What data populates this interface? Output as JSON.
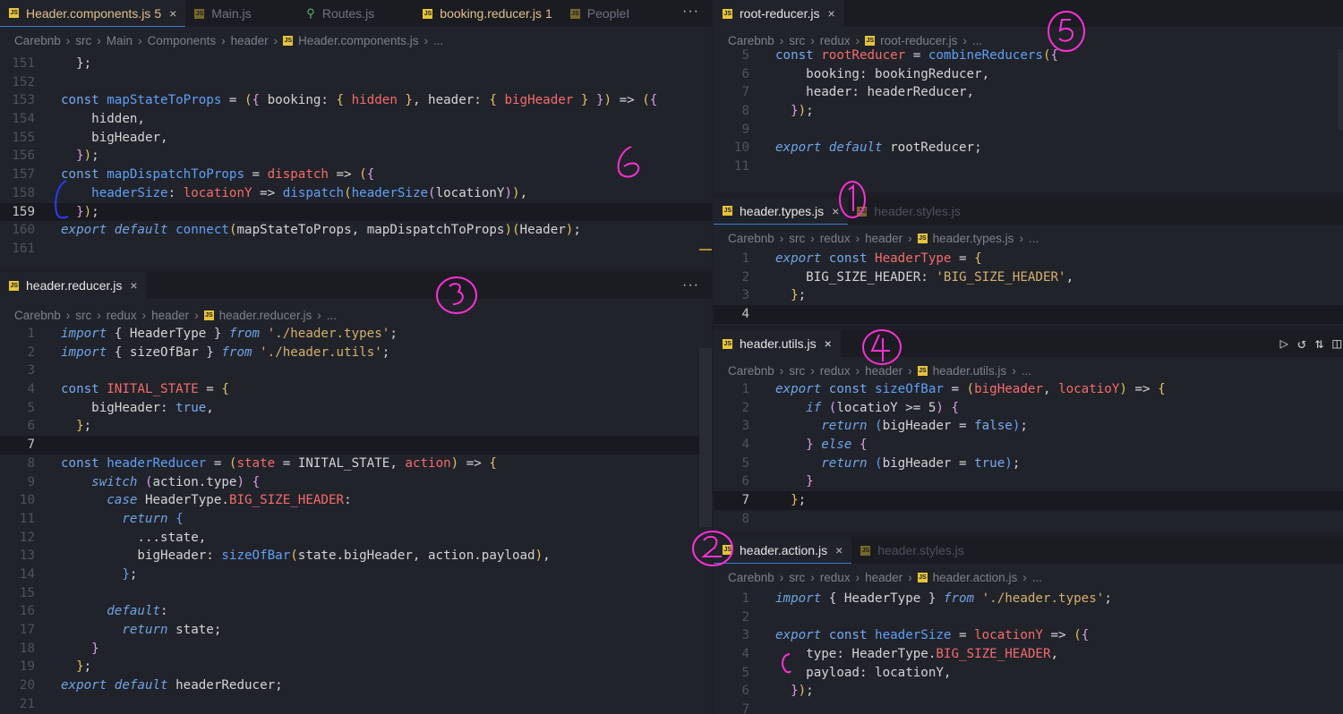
{
  "panes": {
    "header_components": {
      "tabs": [
        {
          "icon": "js-file-icon",
          "label": "Header.components.js",
          "badge": "5",
          "active": true,
          "modified": true
        },
        {
          "icon": "js-file-icon",
          "label": "Main.js",
          "active": false
        },
        {
          "icon": "routes-icon",
          "label": "Routes.js",
          "active": false
        },
        {
          "icon": "js-file-icon",
          "label": "booking.reducer.js",
          "badge": "1",
          "active": false,
          "modified": true
        },
        {
          "icon": "js-file-icon",
          "label": "PeopleI",
          "active": false
        }
      ],
      "more": "···",
      "breadcrumb": [
        "Carebnb",
        "src",
        "Main",
        "Components",
        "header",
        "Header.components.js",
        "..."
      ]
    },
    "header_reducer": {
      "tab": "header.reducer.js",
      "more": "···",
      "breadcrumb": [
        "Carebnb",
        "src",
        "redux",
        "header",
        "header.reducer.js",
        "..."
      ]
    },
    "root_reducer": {
      "tab": "root-reducer.js",
      "breadcrumb": [
        "Carebnb",
        "src",
        "redux",
        "root-reducer.js",
        "..."
      ]
    },
    "header_types": {
      "tabs": [
        "header.types.js",
        "header.styles.js"
      ],
      "breadcrumb": [
        "Carebnb",
        "src",
        "redux",
        "header",
        "header.types.js",
        "..."
      ]
    },
    "header_utils": {
      "tab": "header.utils.js",
      "breadcrumb": [
        "Carebnb",
        "src",
        "redux",
        "header",
        "header.utils.js",
        "..."
      ],
      "actions": [
        "run-icon",
        "history-icon",
        "compare-icon",
        "split-editor-icon"
      ]
    },
    "header_action": {
      "tabs": [
        "header.action.js",
        "header.styles.js"
      ],
      "breadcrumb": [
        "Carebnb",
        "src",
        "redux",
        "header",
        "header.action.js",
        "..."
      ]
    }
  },
  "close_glyph": "×",
  "annotations": [
    "1",
    "2",
    "3",
    "4",
    "5",
    "6"
  ],
  "code": {
    "header_components": [
      {
        "n": "151",
        "tokens": [
          [
            "tx",
            "  };"
          ]
        ]
      },
      {
        "n": "152",
        "tokens": []
      },
      {
        "n": "153",
        "tokens": [
          [
            "k",
            "const "
          ],
          [
            "fn",
            "mapStateToProps"
          ],
          [
            "tx",
            " = "
          ],
          [
            "br",
            "("
          ],
          [
            "pn",
            "{ "
          ],
          [
            "tx",
            "booking: "
          ],
          [
            "br",
            "{ "
          ],
          [
            "var",
            "hidden"
          ],
          [
            "br",
            " }"
          ],
          [
            "tx",
            ", header: "
          ],
          [
            "br",
            "{ "
          ],
          [
            "var",
            "bigHeader"
          ],
          [
            "br",
            " }"
          ],
          [
            "pn",
            " }"
          ],
          [
            "br",
            ")"
          ],
          [
            "tx",
            " => "
          ],
          [
            "br",
            "("
          ],
          [
            "pn",
            "{"
          ]
        ]
      },
      {
        "n": "154",
        "tokens": [
          [
            "tx",
            "    hidden,"
          ]
        ]
      },
      {
        "n": "155",
        "tokens": [
          [
            "tx",
            "    bigHeader,"
          ]
        ]
      },
      {
        "n": "156",
        "tokens": [
          [
            "pn",
            "  }"
          ],
          [
            "br",
            ")"
          ],
          [
            "tx",
            ";"
          ]
        ]
      },
      {
        "n": "157",
        "tokens": [
          [
            "k",
            "const "
          ],
          [
            "fn",
            "mapDispatchToProps"
          ],
          [
            "tx",
            " = "
          ],
          [
            "var",
            "dispatch"
          ],
          [
            "tx",
            " => "
          ],
          [
            "br",
            "("
          ],
          [
            "pn",
            "{"
          ]
        ]
      },
      {
        "n": "158",
        "tokens": [
          [
            "tx",
            "    "
          ],
          [
            "fn",
            "headerSize"
          ],
          [
            "tx",
            ": "
          ],
          [
            "var",
            "locationY"
          ],
          [
            "tx",
            " => "
          ],
          [
            "fn",
            "dispatch"
          ],
          [
            "br",
            "("
          ],
          [
            "fn",
            "headerSize"
          ],
          [
            "pn",
            "("
          ],
          [
            "tx",
            "locationY"
          ],
          [
            "pn",
            ")"
          ],
          [
            "br",
            ")"
          ],
          [
            "tx",
            ","
          ]
        ]
      },
      {
        "n": "159",
        "tokens": [
          [
            "pn",
            "  }"
          ],
          [
            "br",
            ")"
          ],
          [
            "tx",
            ";"
          ]
        ],
        "current": true
      },
      {
        "n": "160",
        "tokens": [
          [
            "kw",
            "export "
          ],
          [
            "kw",
            "default "
          ],
          [
            "fn",
            "connect"
          ],
          [
            "br",
            "("
          ],
          [
            "tx",
            "mapStateToProps, mapDispatchToProps"
          ],
          [
            "br",
            ")"
          ],
          [
            "br",
            "("
          ],
          [
            "tx",
            "Header"
          ],
          [
            "br",
            ")"
          ],
          [
            "tx",
            ";"
          ]
        ]
      },
      {
        "n": "161",
        "tokens": []
      }
    ],
    "header_reducer": [
      {
        "n": "1",
        "tokens": [
          [
            "kw",
            "import "
          ],
          [
            "tx",
            "{ HeaderType } "
          ],
          [
            "kw",
            "from "
          ],
          [
            "str",
            "'./header.types'"
          ],
          [
            "tx",
            ";"
          ]
        ]
      },
      {
        "n": "2",
        "tokens": [
          [
            "kw",
            "import "
          ],
          [
            "tx",
            "{ sizeOfBar } "
          ],
          [
            "kw",
            "from "
          ],
          [
            "str",
            "'./header.utils'"
          ],
          [
            "tx",
            ";"
          ]
        ]
      },
      {
        "n": "3",
        "tokens": []
      },
      {
        "n": "4",
        "tokens": [
          [
            "k",
            "const "
          ],
          [
            "var",
            "INITAL_STATE"
          ],
          [
            "tx",
            " = "
          ],
          [
            "br",
            "{"
          ]
        ]
      },
      {
        "n": "5",
        "tokens": [
          [
            "tx",
            "    bigHeader: "
          ],
          [
            "k",
            "true"
          ],
          [
            "tx",
            ","
          ]
        ]
      },
      {
        "n": "6",
        "tokens": [
          [
            "br",
            "  }"
          ],
          [
            "tx",
            ";"
          ]
        ]
      },
      {
        "n": "7",
        "tokens": [],
        "current": true
      },
      {
        "n": "8",
        "tokens": [
          [
            "k",
            "const "
          ],
          [
            "fn",
            "headerReducer"
          ],
          [
            "tx",
            " = "
          ],
          [
            "br",
            "("
          ],
          [
            "var",
            "state"
          ],
          [
            "tx",
            " = "
          ],
          [
            "tx",
            "INITAL_STATE"
          ],
          [
            "tx",
            ", "
          ],
          [
            "var",
            "action"
          ],
          [
            "br",
            ")"
          ],
          [
            "tx",
            " => "
          ],
          [
            "br",
            "{"
          ]
        ]
      },
      {
        "n": "9",
        "tokens": [
          [
            "kw",
            "    switch "
          ],
          [
            "pn",
            "("
          ],
          [
            "tx",
            "action.type"
          ],
          [
            "pn",
            ")"
          ],
          [
            "pn",
            " {"
          ]
        ]
      },
      {
        "n": "10",
        "tokens": [
          [
            "kw",
            "      case "
          ],
          [
            "tx",
            "HeaderType."
          ],
          [
            "var",
            "BIG_SIZE_HEADER"
          ],
          [
            "tx",
            ":"
          ]
        ]
      },
      {
        "n": "11",
        "tokens": [
          [
            "kw",
            "        return "
          ],
          [
            "fn",
            "{"
          ]
        ]
      },
      {
        "n": "12",
        "tokens": [
          [
            "tx",
            "          ...state,"
          ]
        ]
      },
      {
        "n": "13",
        "tokens": [
          [
            "tx",
            "          bigHeader: "
          ],
          [
            "fn",
            "sizeOfBar"
          ],
          [
            "br",
            "("
          ],
          [
            "tx",
            "state.bigHeader, action.payload"
          ],
          [
            "br",
            ")"
          ],
          [
            "tx",
            ","
          ]
        ]
      },
      {
        "n": "14",
        "tokens": [
          [
            "fn",
            "        }"
          ],
          [
            "tx",
            ";"
          ]
        ]
      },
      {
        "n": "15",
        "tokens": []
      },
      {
        "n": "16",
        "tokens": [
          [
            "kw",
            "      default"
          ],
          [
            "tx",
            ":"
          ]
        ]
      },
      {
        "n": "17",
        "tokens": [
          [
            "kw",
            "        return "
          ],
          [
            "tx",
            "state;"
          ]
        ]
      },
      {
        "n": "18",
        "tokens": [
          [
            "pn",
            "    }"
          ]
        ]
      },
      {
        "n": "19",
        "tokens": [
          [
            "br",
            "  }"
          ],
          [
            "tx",
            ";"
          ]
        ]
      },
      {
        "n": "20",
        "tokens": [
          [
            "kw",
            "export "
          ],
          [
            "kw",
            "default "
          ],
          [
            "tx",
            "headerReducer;"
          ]
        ]
      },
      {
        "n": "21",
        "tokens": []
      }
    ],
    "root_reducer": [
      {
        "n": "5",
        "tokens": [
          [
            "k",
            "const "
          ],
          [
            "var",
            "rootReducer"
          ],
          [
            "tx",
            " = "
          ],
          [
            "fn",
            "combineReducers"
          ],
          [
            "br",
            "("
          ],
          [
            "pn",
            "{"
          ]
        ]
      },
      {
        "n": "6",
        "tokens": [
          [
            "tx",
            "    booking: bookingReducer,"
          ]
        ]
      },
      {
        "n": "7",
        "tokens": [
          [
            "tx",
            "    header: headerReducer,"
          ]
        ]
      },
      {
        "n": "8",
        "tokens": [
          [
            "pn",
            "  }"
          ],
          [
            "br",
            ")"
          ],
          [
            "tx",
            ";"
          ]
        ]
      },
      {
        "n": "9",
        "tokens": []
      },
      {
        "n": "10",
        "tokens": [
          [
            "kw",
            "export "
          ],
          [
            "kw",
            "default "
          ],
          [
            "tx",
            "rootReducer;"
          ]
        ]
      },
      {
        "n": "11",
        "tokens": []
      }
    ],
    "header_types": [
      {
        "n": "1",
        "tokens": [
          [
            "kw",
            "export "
          ],
          [
            "k",
            "const "
          ],
          [
            "var",
            "HeaderType"
          ],
          [
            "tx",
            " = "
          ],
          [
            "br",
            "{"
          ]
        ]
      },
      {
        "n": "2",
        "tokens": [
          [
            "tx",
            "    BIG_SIZE_HEADER: "
          ],
          [
            "str",
            "'BIG_SIZE_HEADER'"
          ],
          [
            "tx",
            ","
          ]
        ]
      },
      {
        "n": "3",
        "tokens": [
          [
            "br",
            "  }"
          ],
          [
            "tx",
            ";"
          ]
        ]
      },
      {
        "n": "4",
        "tokens": [],
        "current": true
      }
    ],
    "header_utils": [
      {
        "n": "1",
        "tokens": [
          [
            "kw",
            "export "
          ],
          [
            "k",
            "const "
          ],
          [
            "fn",
            "sizeOfBar"
          ],
          [
            "tx",
            " = "
          ],
          [
            "br",
            "("
          ],
          [
            "var",
            "bigHeader"
          ],
          [
            "tx",
            ", "
          ],
          [
            "var",
            "locatioY"
          ],
          [
            "br",
            ")"
          ],
          [
            "tx",
            " => "
          ],
          [
            "br",
            "{"
          ]
        ]
      },
      {
        "n": "2",
        "tokens": [
          [
            "kw",
            "    if "
          ],
          [
            "pn",
            "("
          ],
          [
            "tx",
            "locatioY >= 5"
          ],
          [
            "pn",
            ")"
          ],
          [
            "pn",
            " {"
          ]
        ]
      },
      {
        "n": "3",
        "tokens": [
          [
            "kw",
            "      return "
          ],
          [
            "fn",
            "("
          ],
          [
            "tx",
            "bigHeader = "
          ],
          [
            "k",
            "false"
          ],
          [
            "fn",
            ")"
          ],
          [
            "tx",
            ";"
          ]
        ]
      },
      {
        "n": "4",
        "tokens": [
          [
            "pn",
            "    } "
          ],
          [
            "kw",
            "else "
          ],
          [
            "pn",
            "{"
          ]
        ]
      },
      {
        "n": "5",
        "tokens": [
          [
            "kw",
            "      return "
          ],
          [
            "fn",
            "("
          ],
          [
            "tx",
            "bigHeader = "
          ],
          [
            "k",
            "true"
          ],
          [
            "fn",
            ")"
          ],
          [
            "tx",
            ";"
          ]
        ]
      },
      {
        "n": "6",
        "tokens": [
          [
            "pn",
            "    }"
          ]
        ]
      },
      {
        "n": "7",
        "tokens": [
          [
            "br",
            "  }"
          ],
          [
            "tx",
            ";"
          ]
        ],
        "current": true
      },
      {
        "n": "8",
        "tokens": []
      }
    ],
    "header_action": [
      {
        "n": "1",
        "tokens": [
          [
            "kw",
            "import "
          ],
          [
            "tx",
            "{ HeaderType } "
          ],
          [
            "kw",
            "from "
          ],
          [
            "str",
            "'./header.types'"
          ],
          [
            "tx",
            ";"
          ]
        ]
      },
      {
        "n": "2",
        "tokens": []
      },
      {
        "n": "3",
        "tokens": [
          [
            "kw",
            "export "
          ],
          [
            "k",
            "const "
          ],
          [
            "fn",
            "headerSize"
          ],
          [
            "tx",
            " = "
          ],
          [
            "var",
            "locationY"
          ],
          [
            "tx",
            " => "
          ],
          [
            "br",
            "("
          ],
          [
            "pn",
            "{"
          ]
        ]
      },
      {
        "n": "4",
        "tokens": [
          [
            "tx",
            "    type: HeaderType."
          ],
          [
            "var",
            "BIG_SIZE_HEADER"
          ],
          [
            "tx",
            ","
          ]
        ]
      },
      {
        "n": "5",
        "tokens": [
          [
            "tx",
            "    payload: locationY,"
          ]
        ]
      },
      {
        "n": "6",
        "tokens": [
          [
            "pn",
            "  }"
          ],
          [
            "br",
            ")"
          ],
          [
            "tx",
            ";"
          ]
        ]
      },
      {
        "n": "7",
        "tokens": []
      }
    ]
  }
}
